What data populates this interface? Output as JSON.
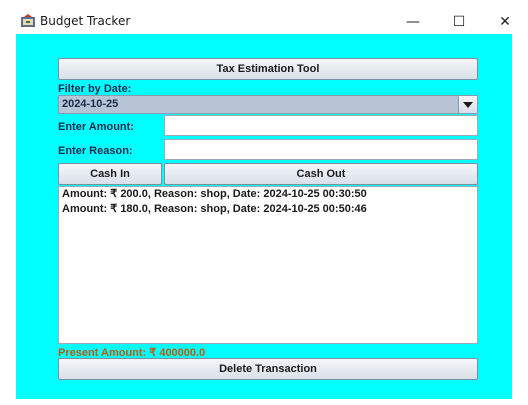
{
  "window": {
    "title": "Budget Tracker",
    "minimize_glyph": "—",
    "maximize_glyph": "☐",
    "close_glyph": "✕"
  },
  "tax_button": {
    "label": "Tax Estimation Tool"
  },
  "filter": {
    "label": "Filter by Date:",
    "selected": "2024-10-25"
  },
  "amount": {
    "label": "Enter Amount:",
    "value": ""
  },
  "reason": {
    "label": "Enter Reason:",
    "value": ""
  },
  "cash_in_button": {
    "label": "Cash In"
  },
  "cash_out_button": {
    "label": "Cash Out"
  },
  "transactions": [
    "Amount: ₹ 200.0, Reason: shop, Date: 2024-10-25 00:30:50",
    "Amount: ₹ 180.0, Reason: shop, Date: 2024-10-25 00:50:46"
  ],
  "present_amount": {
    "text": "Present Amount: ₹ 400000.0"
  },
  "delete_button": {
    "label": "Delete Transaction"
  },
  "colors": {
    "background": "#00ffff",
    "present_amount": "#c25a12",
    "combo_fill": "#b7c4d6"
  },
  "icons": {
    "app": "app-icon",
    "dropdown": "chevron-down-icon"
  }
}
